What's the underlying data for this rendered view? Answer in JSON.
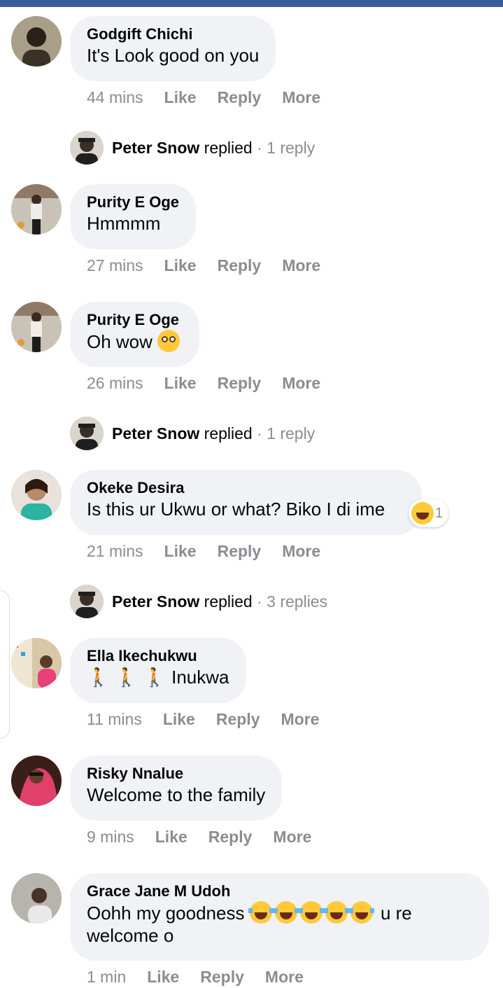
{
  "comments": [
    {
      "author": "Godgift Chichi",
      "text": "It's Look good on you",
      "time": "44 mins",
      "avatar_icon": "avatar-photo"
    },
    {
      "author": "Purity E Oge",
      "text": "Hmmmm",
      "time": "27 mins",
      "avatar_icon": "avatar-photo"
    },
    {
      "author": "Purity E Oge",
      "text": "Oh wow",
      "emoji": "flushed-face",
      "time": "26 mins",
      "avatar_icon": "avatar-photo"
    },
    {
      "author": "Okeke Desira",
      "text": "Is this ur Ukwu or what? Biko I di ime",
      "reaction_count": "1",
      "reaction_icon": "laughing-face",
      "time": "21 mins",
      "avatar_icon": "avatar-photo"
    },
    {
      "author": "Ella Ikechukwu",
      "text": "Inukwa",
      "emoji": "person-walking x3",
      "time": "11 mins",
      "avatar_icon": "avatar-photo"
    },
    {
      "author": "Risky Nnalue",
      "text": "Welcome to the family",
      "time": "9 mins",
      "avatar_icon": "avatar-photo"
    },
    {
      "author": "Grace Jane M Udoh",
      "text_before": "Oohh my goodness",
      "text_after": "u re",
      "text_line2": "welcome o",
      "emoji": "tears-of-joy x5",
      "time": "1 min",
      "avatar_icon": "avatar-photo"
    }
  ],
  "replies": [
    {
      "name": "Peter Snow",
      "verb": "replied",
      "sep": " · ",
      "count": "1 reply"
    },
    {
      "name": "Peter Snow",
      "verb": "replied",
      "sep": " · ",
      "count": "1 reply"
    },
    {
      "name": "Peter Snow",
      "verb": "replied",
      "sep": " · ",
      "count": "3 replies"
    }
  ],
  "actions": {
    "like": "Like",
    "reply": "Reply",
    "more": "More"
  },
  "colors": {
    "top_bar": "#3b5a9a",
    "bubble": "#f0f2f5",
    "meta_text": "#8a8d91"
  }
}
